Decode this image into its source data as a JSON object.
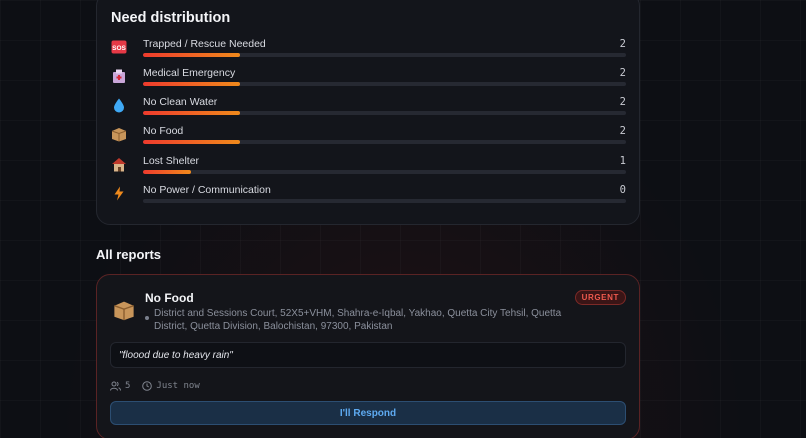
{
  "distribution": {
    "title": "Need distribution",
    "needs": [
      {
        "icon": "sos-icon",
        "glyph": "🆘",
        "label": "Trapped / Rescue Needed",
        "count": "2",
        "fraction": 0.2
      },
      {
        "icon": "hospital-icon",
        "glyph": "🏥",
        "label": "Medical Emergency",
        "count": "2",
        "fraction": 0.2
      },
      {
        "icon": "water-drop-icon",
        "glyph": "💧",
        "label": "No Clean Water",
        "count": "2",
        "fraction": 0.2
      },
      {
        "icon": "package-icon",
        "glyph": "📦",
        "label": "No Food",
        "count": "2",
        "fraction": 0.2
      },
      {
        "icon": "house-icon",
        "glyph": "🏚",
        "label": "Lost Shelter",
        "count": "1",
        "fraction": 0.1
      },
      {
        "icon": "lightning-icon",
        "glyph": "⚡",
        "label": "No Power / Communication",
        "count": "0",
        "fraction": 0
      }
    ]
  },
  "reports": {
    "section_title": "All reports",
    "items": [
      {
        "icon": "package-icon",
        "glyph": "📦",
        "title": "No Food",
        "badge": "URGENT",
        "address": "District and Sessions Court, 52X5+VHM, Shahra-e-Iqbal, Yakhao, Quetta City Tehsil, Quetta District, Quetta Division, Balochistan, 97300, Pakistan",
        "quote": "\"floood due to heavy rain\"",
        "people_count": "5",
        "time": "Just now",
        "respond_label": "I'll Respond"
      }
    ]
  },
  "colors": {
    "bar_start": "#ef3b2d",
    "bar_end": "#f08a1c",
    "urgent": "#ef5a4e",
    "respond": "#5eaaf0"
  }
}
